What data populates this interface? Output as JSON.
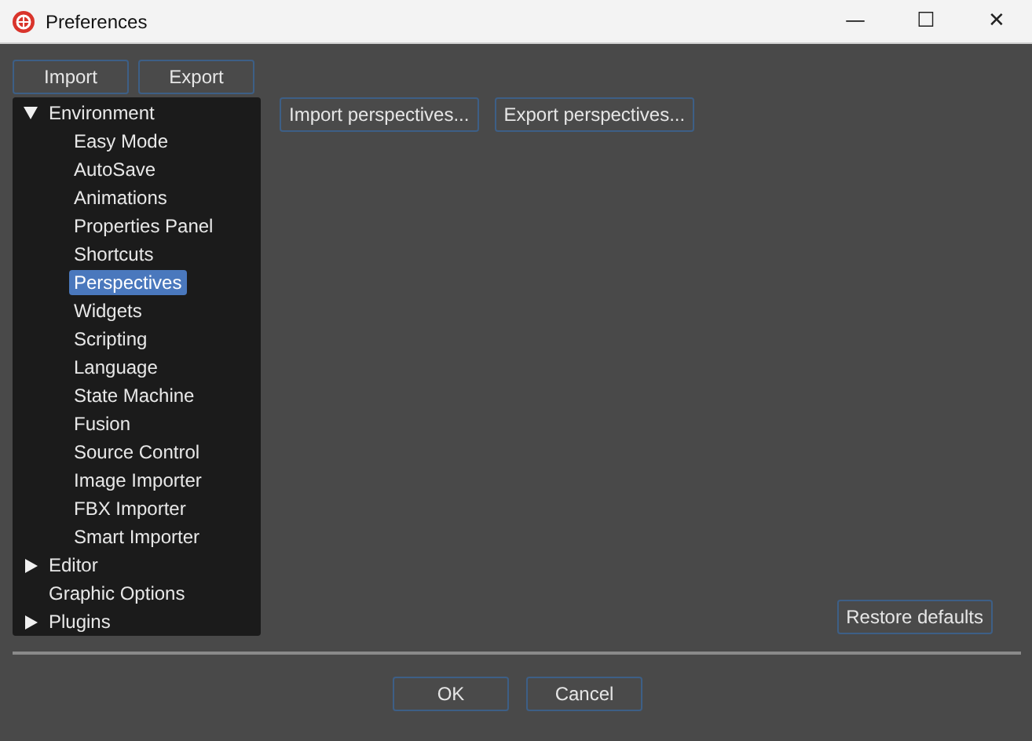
{
  "window": {
    "title": "Preferences",
    "controls": [
      "—",
      "☐",
      "✕"
    ]
  },
  "top_buttons": [
    "Import",
    "Export"
  ],
  "tree": [
    {
      "label": "Environment",
      "expanded": true,
      "selected": false,
      "children": [
        {
          "label": "Easy Mode",
          "selected": false
        },
        {
          "label": "AutoSave",
          "selected": false
        },
        {
          "label": "Animations",
          "selected": false
        },
        {
          "label": "Properties Panel",
          "selected": false
        },
        {
          "label": "Shortcuts",
          "selected": false
        },
        {
          "label": "Perspectives",
          "selected": true
        },
        {
          "label": "Widgets",
          "selected": false
        },
        {
          "label": "Scripting",
          "selected": false
        },
        {
          "label": "Language",
          "selected": false
        },
        {
          "label": "State Machine",
          "selected": false
        },
        {
          "label": "Fusion",
          "selected": false
        },
        {
          "label": "Source Control",
          "selected": false
        },
        {
          "label": "Image Importer",
          "selected": false
        },
        {
          "label": "FBX Importer",
          "selected": false
        },
        {
          "label": "Smart Importer",
          "selected": false
        }
      ]
    },
    {
      "label": "Editor",
      "expanded": false,
      "selected": false
    },
    {
      "label": "Graphic Options",
      "selected": false
    },
    {
      "label": "Plugins",
      "expanded": false,
      "selected": false
    }
  ],
  "panel_buttons": [
    "Import perspectives...",
    "Export perspectives..."
  ],
  "restore_button": "Restore defaults",
  "dialog_buttons": [
    "OK",
    "Cancel"
  ]
}
